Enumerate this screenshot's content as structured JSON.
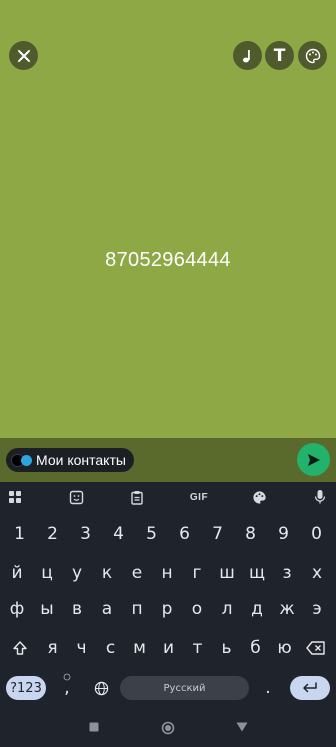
{
  "story": {
    "text": "87052964444",
    "background_color": "#8ea845"
  },
  "top_controls": {
    "close_icon": "close-icon",
    "music_icon": "music-note-icon",
    "text_label": "T",
    "palette_icon": "palette-icon"
  },
  "bottom_bar": {
    "audience_label": "Мои контакты",
    "send_icon": "send-icon"
  },
  "keyboard": {
    "toolbar": {
      "gif_label": "GIF"
    },
    "rows": [
      [
        "1",
        "2",
        "3",
        "4",
        "5",
        "6",
        "7",
        "8",
        "9",
        "0"
      ],
      [
        "й",
        "ц",
        "у",
        "к",
        "е",
        "н",
        "г",
        "ш",
        "щ",
        "з",
        "х"
      ],
      [
        "ф",
        "ы",
        "в",
        "а",
        "п",
        "р",
        "о",
        "л",
        "д",
        "ж",
        "э"
      ],
      [
        "я",
        "ч",
        "с",
        "м",
        "и",
        "т",
        "ь",
        "б",
        "ю"
      ]
    ],
    "mode_label": "?123",
    "comma_label": ",",
    "space_label": "Русский",
    "period_label": "."
  },
  "colors": {
    "accent_send": "#22b26b",
    "keyboard_bg": "#1f232b"
  }
}
